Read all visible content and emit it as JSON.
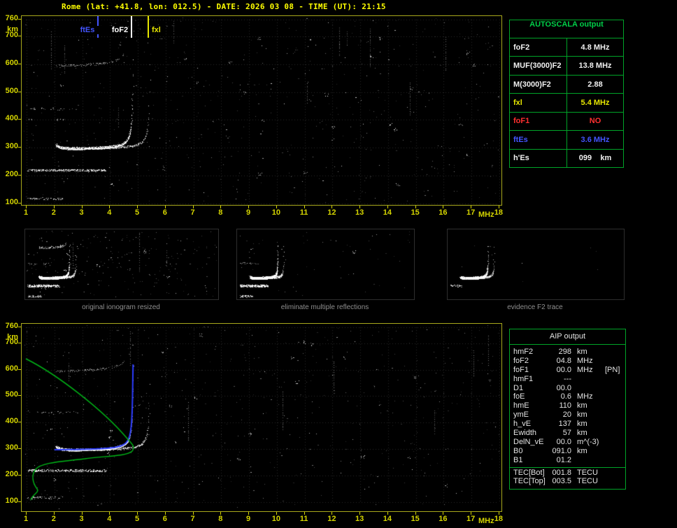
{
  "header": {
    "title": "Rome (lat: +41.8, lon: 012.5) - DATE: 2026 03 08 - TIME (UT): 21:15"
  },
  "colors": {
    "axis_yellow": "#d6d600",
    "title_yellow": "#ffff00",
    "table_green": "#00a428",
    "trace_white": "#ffffff",
    "profile_green": "#00b818",
    "restored_trace_blue": "#2b3cff"
  },
  "top_plot": {
    "y_unit": "km",
    "x_unit": "MHz",
    "y_ticks": [
      "760",
      "700",
      "600",
      "500",
      "400",
      "300",
      "200",
      "100"
    ],
    "x_ticks": [
      "1",
      "2",
      "3",
      "4",
      "5",
      "6",
      "7",
      "8",
      "9",
      "10",
      "11",
      "12",
      "13",
      "14",
      "15",
      "16",
      "17",
      "18"
    ],
    "markers": [
      {
        "label": "ftEs",
        "freq_mhz": 3.6,
        "color": "#4455ff"
      },
      {
        "label": "foF2",
        "freq_mhz": 4.8,
        "color": "#ffffff"
      },
      {
        "label": "fxl",
        "freq_mhz": 5.4,
        "color": "#e6e600"
      }
    ]
  },
  "bottom_plot": {
    "y_unit": "km",
    "x_unit": "MHz",
    "y_ticks": [
      "760",
      "700",
      "600",
      "500",
      "400",
      "300",
      "200",
      "100"
    ],
    "x_ticks": [
      "1",
      "2",
      "3",
      "4",
      "5",
      "6",
      "7",
      "8",
      "9",
      "10",
      "11",
      "12",
      "13",
      "14",
      "15",
      "16",
      "17",
      "18"
    ],
    "curves": [
      {
        "name": "electron-density-profile",
        "color": "#00b818"
      },
      {
        "name": "restored-trace",
        "color": "#2b3cff"
      }
    ]
  },
  "autoscala_table": {
    "title": "AUTOSCALA output",
    "rows": [
      {
        "label": "foF2",
        "value": "4.8 MHz",
        "color": "#f0f0f0"
      },
      {
        "label": "MUF(3000)F2",
        "value": "13.8 MHz",
        "color": "#f0f0f0"
      },
      {
        "label": "M(3000)F2",
        "value": "2.88",
        "color": "#f0f0f0"
      },
      {
        "label": "fxl",
        "value": "5.4 MHz",
        "color": "#e6e600"
      },
      {
        "label": "foF1",
        "value": "NO",
        "color": "#ff3030"
      },
      {
        "label": "ftEs",
        "value": "3.6 MHz",
        "color": "#4455ff"
      },
      {
        "label": "h'Es",
        "value": "099    km",
        "color": "#f0f0f0"
      }
    ]
  },
  "panels": [
    {
      "caption": "original ionogram resized"
    },
    {
      "caption": "eliminate multiple reflections"
    },
    {
      "caption": "evidence F2 trace"
    }
  ],
  "aip_table": {
    "title": "AIP output",
    "rows": [
      {
        "label": "hmF2",
        "value": "298",
        "unit": "km"
      },
      {
        "label": "foF2",
        "value": "04.8",
        "unit": "MHz"
      },
      {
        "label": "foF1",
        "value": "00.0",
        "unit": "MHz",
        "extra": "[PN]"
      },
      {
        "label": "hmF1",
        "value": "---",
        "unit": ""
      },
      {
        "label": "D1",
        "value": "00.0",
        "unit": ""
      },
      {
        "label": "foE",
        "value": "0.6",
        "unit": "MHz"
      },
      {
        "label": "hmE",
        "value": "110",
        "unit": "km"
      },
      {
        "label": "ymE",
        "value": "20",
        "unit": "km"
      },
      {
        "label": "h_vE",
        "value": "137",
        "unit": "km"
      },
      {
        "label": "Ewidth",
        "value": "57",
        "unit": "km"
      },
      {
        "label": "DelN_vE",
        "value": "00.0",
        "unit": "m^(-3)"
      },
      {
        "label": "B0",
        "value": "091.0",
        "unit": "km"
      },
      {
        "label": "B1",
        "value": "01.2",
        "unit": ""
      },
      {
        "label": "TEC[Bot]",
        "value": "001.8",
        "unit": "TECU",
        "separator_above": true
      },
      {
        "label": "TEC[Top]",
        "value": "003.5",
        "unit": "TECU"
      }
    ]
  }
}
